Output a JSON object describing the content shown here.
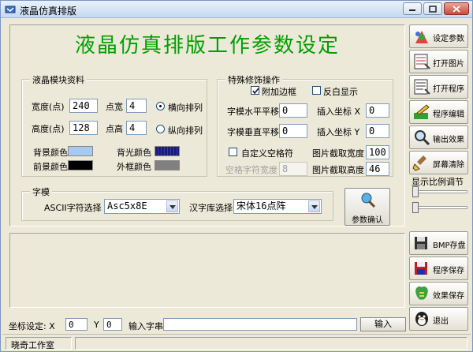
{
  "window": {
    "title": "液晶仿真排版"
  },
  "heading": "液晶仿真排版工作参数设定",
  "lcd_group": {
    "title": "液晶模块资料",
    "width_label": "宽度(点)",
    "width_value": "240",
    "height_label": "高度(点)",
    "height_value": "128",
    "dot_w_label": "点宽",
    "dot_w_value": "4",
    "dot_h_label": "点高",
    "dot_h_value": "4",
    "radio_h_label": "横向排列",
    "radio_v_label": "纵向排列",
    "radio_selected": "横向排列",
    "bg_label": "背景颜色",
    "bg_color": "#a6caf0",
    "fg_label": "前景颜色",
    "fg_color": "#000000",
    "backlight_label": "背光颜色",
    "backlight_color": "#1a1a7a",
    "frame_label": "外框颜色",
    "frame_color": "#808080"
  },
  "effects_group": {
    "title": "特殊修饰操作",
    "add_border_label": "附加边框",
    "add_border_checked": true,
    "invert_label": "反白显示",
    "invert_checked": false,
    "h_offset_label": "字模水平平移",
    "h_offset_value": "0",
    "v_offset_label": "字模垂直平移",
    "v_offset_value": "0",
    "insert_x_label": "插入坐标 X",
    "insert_x_value": "0",
    "insert_y_label": "插入坐标 Y",
    "insert_y_value": "0",
    "custom_space_label": "自定义空格符",
    "custom_space_checked": false,
    "space_width_label": "空格字符宽度",
    "space_width_value": "8",
    "crop_w_label": "图片截取宽度",
    "crop_w_value": "100",
    "crop_h_label": "图片截取高度",
    "crop_h_value": "46"
  },
  "font_group": {
    "title": "字模",
    "ascii_label": "ASCII字符选择",
    "ascii_value": "Asc5x8E",
    "hz_label": "汉字库选择",
    "hz_value": "宋体16点阵"
  },
  "confirm_button": {
    "label": "参数确认"
  },
  "sidebar": {
    "buttons": [
      {
        "label": "设定参数",
        "icon": "settings-icon"
      },
      {
        "label": "打开图片",
        "icon": "open-image-icon"
      },
      {
        "label": "打开程序",
        "icon": "open-program-icon"
      },
      {
        "label": "程序编辑",
        "icon": "edit-program-icon"
      },
      {
        "label": "输出效果",
        "icon": "output-effect-icon"
      },
      {
        "label": "屏幕清除",
        "icon": "clear-screen-icon"
      }
    ],
    "scale_label": "显示比例调节",
    "buttons_bottom": [
      {
        "label": "BMP存盘",
        "icon": "bmp-save-icon"
      },
      {
        "label": "程序保存",
        "icon": "program-save-icon"
      },
      {
        "label": "效果保存",
        "icon": "effect-save-icon"
      },
      {
        "label": "退出",
        "icon": "exit-icon"
      }
    ]
  },
  "status": {
    "coord_label": "坐标设定: X",
    "coord_x_value": "0",
    "y_label": "Y",
    "coord_y_value": "0",
    "input_label": "输入字串",
    "input_value": "",
    "input_button": "输入"
  },
  "footer": {
    "studio": "晓奇工作室"
  }
}
